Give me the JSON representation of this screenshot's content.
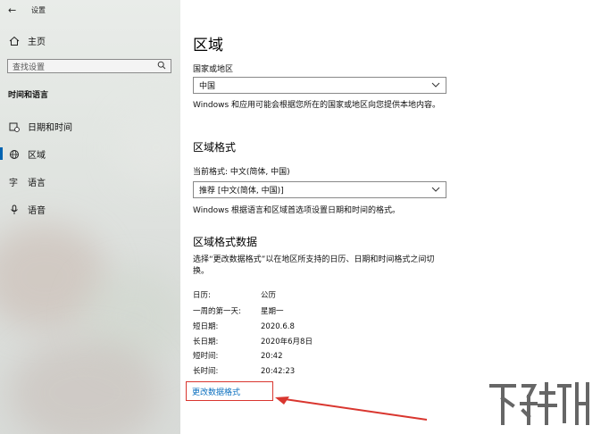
{
  "sidebar": {
    "back_icon": "back-arrow-icon",
    "app_title": "设置",
    "home_label": "主页",
    "search_placeholder": "查找设置",
    "section_title": "时间和语言",
    "items": [
      {
        "label": "日期和时间",
        "icon": "calendar-clock-icon"
      },
      {
        "label": "区域",
        "icon": "globe-icon"
      },
      {
        "label": "语言",
        "icon": "language-icon"
      },
      {
        "label": "语音",
        "icon": "microphone-icon"
      }
    ],
    "active_item": "区域",
    "accent_color": "#0063b1"
  },
  "main": {
    "title": "区域",
    "country_label": "国家或地区",
    "country_value": "中国",
    "country_desc": "Windows 和应用可能会根据您所在的国家或地区向您提供本地内容。",
    "format_heading": "区域格式",
    "current_format_label": "当前格式: 中文(简体, 中国)",
    "format_value": "推荐 [中文(简体, 中国)]",
    "format_desc": "Windows 根据语言和区域首选项设置日期和时间的格式。",
    "data_heading": "区域格式数据",
    "data_desc_line1": "选择“更改数据格式”以在地区所支持的日历、日期和时间格式之间切",
    "data_desc_line2": "换。",
    "rows": [
      {
        "key": "日历:",
        "value": "公历"
      },
      {
        "key": "一周的第一天:",
        "value": "星期一"
      },
      {
        "key": "短日期:",
        "value": "2020.6.8"
      },
      {
        "key": "长日期:",
        "value": "2020年6月8日"
      },
      {
        "key": "短时间:",
        "value": "20:42"
      },
      {
        "key": "长时间:",
        "value": "20:42:23"
      }
    ],
    "change_link": "更改数据格式",
    "link_color": "#0a6fbf",
    "highlight_color": "#d9362f"
  }
}
